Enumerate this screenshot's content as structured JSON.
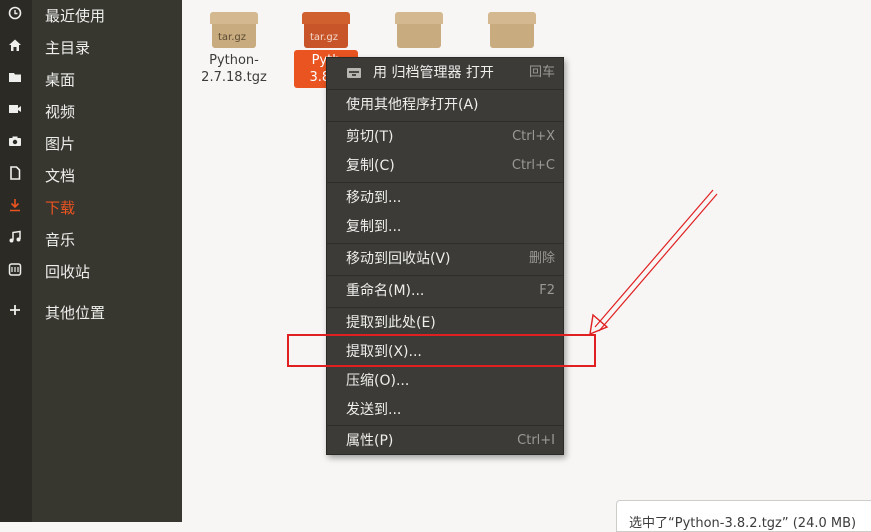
{
  "sidebar": {
    "items": [
      {
        "label": "最近使用",
        "icon": "clock-icon"
      },
      {
        "label": "主目录",
        "icon": "home-icon"
      },
      {
        "label": "桌面",
        "icon": "folder-icon"
      },
      {
        "label": "视频",
        "icon": "video-icon"
      },
      {
        "label": "图片",
        "icon": "camera-icon"
      },
      {
        "label": "文档",
        "icon": "document-icon"
      },
      {
        "label": "下载",
        "icon": "download-icon"
      },
      {
        "label": "音乐",
        "icon": "music-icon"
      },
      {
        "label": "回收站",
        "icon": "trash-icon"
      },
      {
        "label": "其他位置",
        "icon": "plus-icon"
      }
    ],
    "active_color": "#e95420"
  },
  "files": [
    {
      "type_label": "tar.gz",
      "name_line1": "Python-",
      "name_line2": "2.7.18.tgz"
    },
    {
      "type_label": "tar.gz",
      "name_line1": "Pyth",
      "name_line2": "3.8.2"
    }
  ],
  "context_menu": {
    "open_with_archive": {
      "label": "用 归档管理器 打开",
      "shortcut": "回车",
      "icon": "archive-manager-icon"
    },
    "open_with_other": {
      "label": "使用其他程序打开(A)"
    },
    "cut": {
      "label": "剪切(T)",
      "shortcut": "Ctrl+X"
    },
    "copy": {
      "label": "复制(C)",
      "shortcut": "Ctrl+C"
    },
    "move_to": {
      "label": "移动到..."
    },
    "copy_to": {
      "label": "复制到..."
    },
    "move_to_trash": {
      "label": "移动到回收站(V)",
      "shortcut": "删除"
    },
    "rename": {
      "label": "重命名(M)...",
      "shortcut": "F2"
    },
    "extract_here": {
      "label": "提取到此处(E)"
    },
    "extract_to": {
      "label": "提取到(X)..."
    },
    "compress": {
      "label": "压缩(O)..."
    },
    "send_to": {
      "label": "发送到..."
    },
    "properties": {
      "label": "属性(P)",
      "shortcut": "Ctrl+I"
    }
  },
  "status_bar": {
    "text": "选中了“Python-3.8.2.tgz” (24.0 MB)"
  },
  "colors": {
    "highlight_box": "#e02020",
    "arrow": "#e02020",
    "selected_file": "#e95420"
  }
}
